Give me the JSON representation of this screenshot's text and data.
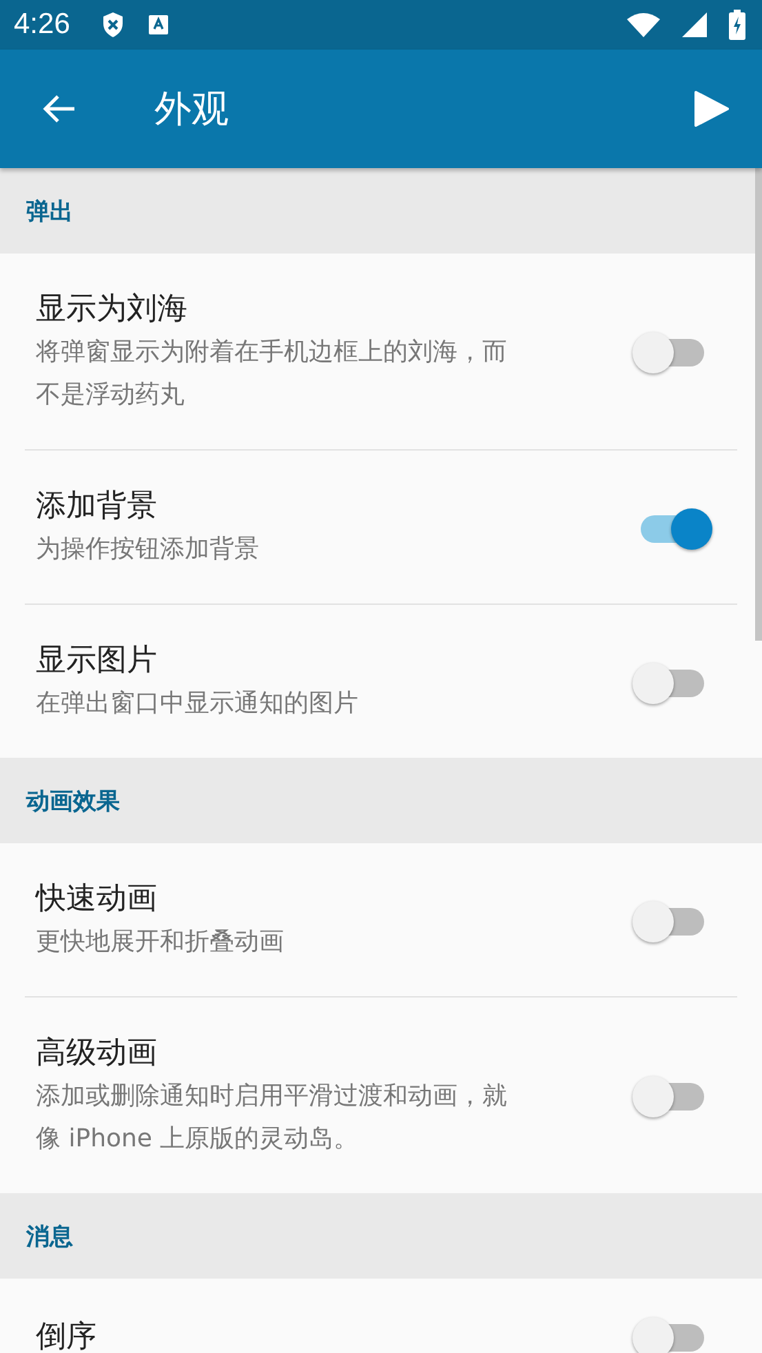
{
  "status_bar": {
    "time": "4:26"
  },
  "app_bar": {
    "title": "外观"
  },
  "sections": [
    {
      "title": "弹出",
      "items": [
        {
          "title": "显示为刘海",
          "subtitle": "将弹窗显示为附着在手机边框上的刘海，而不是浮动药丸",
          "on": false
        },
        {
          "title": "添加背景",
          "subtitle": "为操作按钮添加背景",
          "on": true
        },
        {
          "title": "显示图片",
          "subtitle": "在弹出窗口中显示通知的图片",
          "on": false
        }
      ]
    },
    {
      "title": "动画效果",
      "items": [
        {
          "title": "快速动画",
          "subtitle": "更快地展开和折叠动画",
          "on": false
        },
        {
          "title": "高级动画",
          "subtitle": "添加或删除通知时启用平滑过渡和动画，就像 iPhone 上原版的灵动岛。",
          "on": false
        }
      ]
    },
    {
      "title": "消息",
      "items": [
        {
          "title": "倒序",
          "on": false
        }
      ]
    }
  ]
}
